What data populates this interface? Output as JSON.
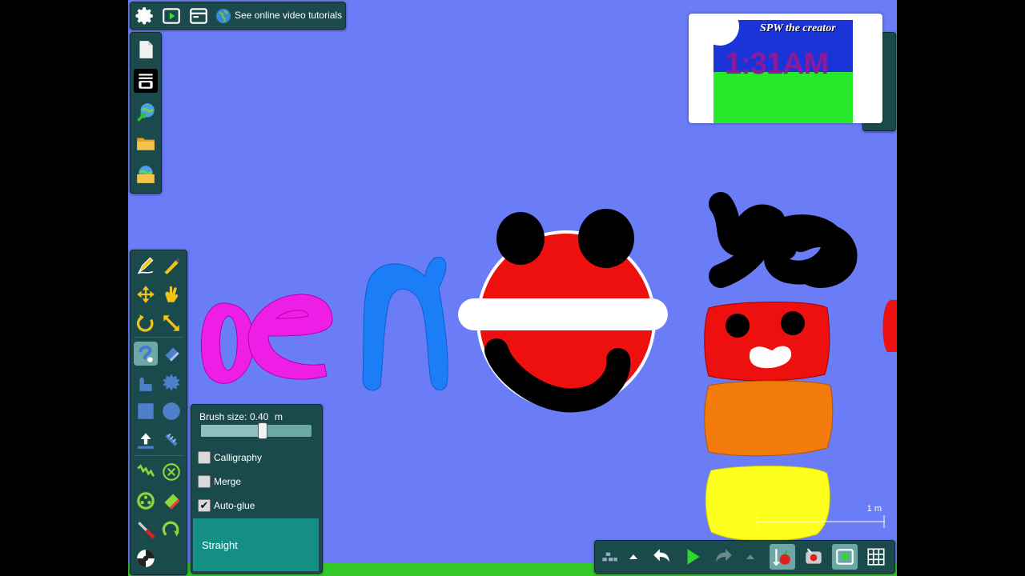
{
  "top_bar": {
    "icons": [
      "gear-icon",
      "play-icon",
      "window-icon",
      "globe-icon"
    ],
    "tutorial_label": "See online video tutorials"
  },
  "file_panel": {
    "icons": [
      "new-file-icon",
      "layers-icon",
      "share-icon",
      "open-folder-icon",
      "save-icon"
    ]
  },
  "tool_panel": {
    "icons": [
      "draw-icon",
      "cut-icon",
      "move-icon",
      "grab-icon",
      "rotate-icon",
      "scale-icon",
      "draw-shape-icon",
      "eraser-icon",
      "rectangle-icon",
      "gear-shape-icon",
      "box-icon",
      "circle-icon",
      "thrust-icon",
      "rope-icon",
      "spring-icon",
      "hinge-icon",
      "wheel-icon",
      "destroy-icon",
      "knife-icon",
      "trace-icon",
      "laser-icon"
    ]
  },
  "brush_panel": {
    "size_label": "Brush size:",
    "size_value": "0.40",
    "size_unit": "m",
    "size_fraction": 0.55,
    "calligraphy_label": "Calligraphy",
    "calligraphy_checked": false,
    "merge_label": "Merge",
    "merge_checked": false,
    "autoglue_label": "Auto-glue",
    "autoglue_checked": true,
    "straight_label": "Straight"
  },
  "preview": {
    "title": "SPW the creator",
    "time": "1:31AM"
  },
  "bottom_bar": {
    "icons": [
      "grid-toggle-icon",
      "menu-up-icon",
      "undo-icon",
      "play-icon",
      "redo-icon",
      "menu-up-icon-2",
      "gravity-icon",
      "camera-icon",
      "settings-icon",
      "grid-icon"
    ]
  },
  "scale": {
    "label": "1 m"
  },
  "colors": {
    "background": "#6b7cf7",
    "panel": "#1b4a4d",
    "accent": "#138f86",
    "ground": "#35c82a"
  }
}
